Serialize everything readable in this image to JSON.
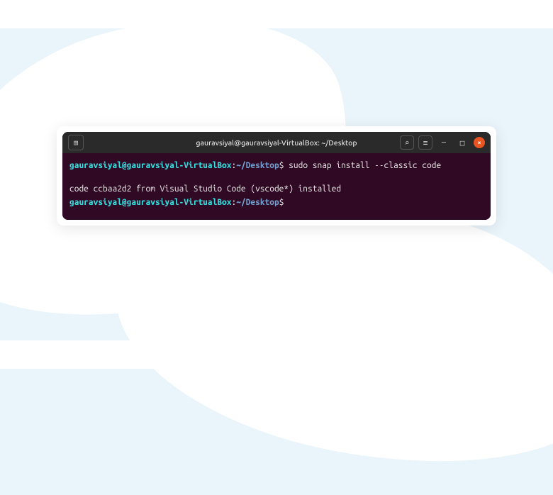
{
  "titlebar": {
    "title": "gauravsiyal@gauravsiyal-VirtualBox: ~/Desktop",
    "new_tab_icon": "⊞",
    "search_icon": "⌕",
    "menu_icon": "≡",
    "minimize_icon": "—",
    "maximize_icon": "□",
    "close_icon": "×"
  },
  "terminal": {
    "lines": [
      {
        "type": "prompt_cmd",
        "user_host": "gauravsiyal@gauravsiyal-VirtualBox",
        "colon": ":",
        "path": "~/Desktop",
        "dollar": "$",
        "command": " sudo snap install --classic code"
      },
      {
        "type": "blank"
      },
      {
        "type": "output",
        "text": "code ccbaa2d2 from Visual Studio Code (vscode*) installed"
      },
      {
        "type": "prompt",
        "user_host": "gauravsiyal@gauravsiyal-VirtualBox",
        "colon": ":",
        "path": "~/Desktop",
        "dollar": "$"
      }
    ]
  }
}
